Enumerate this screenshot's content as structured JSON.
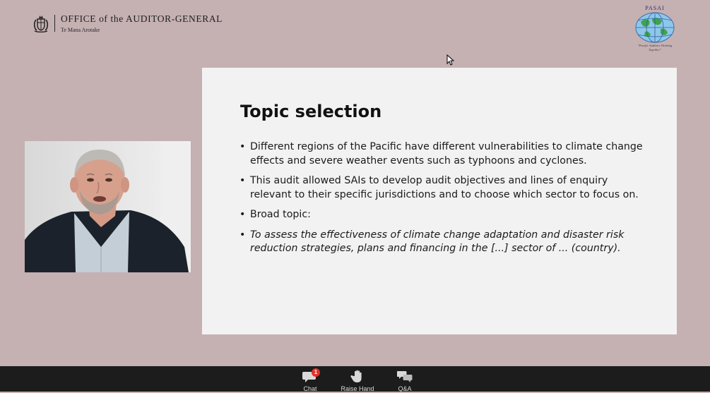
{
  "header": {
    "oag_logo": {
      "title": "OFFICE of the AUDITOR-GENERAL",
      "subtitle": "Te Mana Arotake",
      "icon": "nz-coat-of-arms-icon"
    },
    "pasai_logo": {
      "name": "PASAI",
      "motto": "\"Pacific Auditors Working Together\"",
      "icon": "globe-icon"
    }
  },
  "slide": {
    "title": "Topic selection",
    "bullets": [
      "Different regions of the Pacific have different vulnerabilities to climate change effects and severe weather events such as typhoons and cyclones.",
      "This audit allowed SAIs to develop audit objectives and lines of enquiry relevant to their specific jurisdictions and to choose which sector to focus on.",
      "Broad topic:",
      "To assess the effectiveness of climate change adaptation and disaster risk reduction strategies, plans and financing in the [...] sector of ... (country)."
    ]
  },
  "toolbar": {
    "chat": {
      "label": "Chat",
      "badge": "1",
      "icon": "chat-icon"
    },
    "raise_hand": {
      "label": "Raise Hand",
      "icon": "hand-icon"
    },
    "qa": {
      "label": "Q&A",
      "icon": "qa-icon"
    }
  },
  "colors": {
    "background": "#c5b0b2",
    "slide": "#f2f2f2",
    "toolbar": "#1c1c1c",
    "badge": "#e0322b"
  }
}
